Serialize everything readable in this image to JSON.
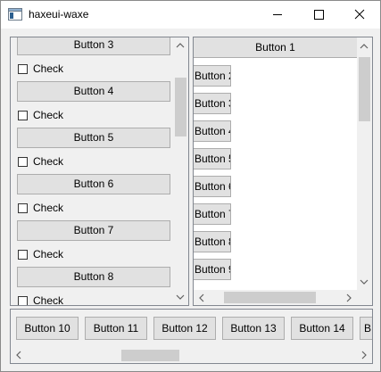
{
  "window": {
    "title": "haxeui-waxe"
  },
  "left_panel": {
    "items": [
      {
        "button": "Button 3",
        "check": "Check"
      },
      {
        "button": "Button 4",
        "check": "Check"
      },
      {
        "button": "Button 5",
        "check": "Check"
      },
      {
        "button": "Button 6",
        "check": "Check"
      },
      {
        "button": "Button 7",
        "check": "Check"
      },
      {
        "button": "Button 8",
        "check": "Check"
      }
    ]
  },
  "right_panel": {
    "header_button": "Button 1",
    "buttons": [
      "Button 2",
      "Button 3",
      "Button 4",
      "Button 5",
      "Button 6",
      "Button 7",
      "Button 8",
      "Button 9"
    ]
  },
  "bottom_panel": {
    "buttons": [
      "Button 10",
      "Button 11",
      "Button 12",
      "Button 13",
      "Button 14",
      "B"
    ]
  },
  "colors": {
    "accent": "#0078d7",
    "button_face": "#e1e1e1",
    "button_border": "#adadad",
    "thumb": "#cdcdcd"
  },
  "icons": [
    "app-icon",
    "minimize-icon",
    "maximize-icon",
    "close-icon",
    "chevron-up-icon",
    "chevron-down-icon",
    "chevron-left-icon",
    "chevron-right-icon"
  ]
}
